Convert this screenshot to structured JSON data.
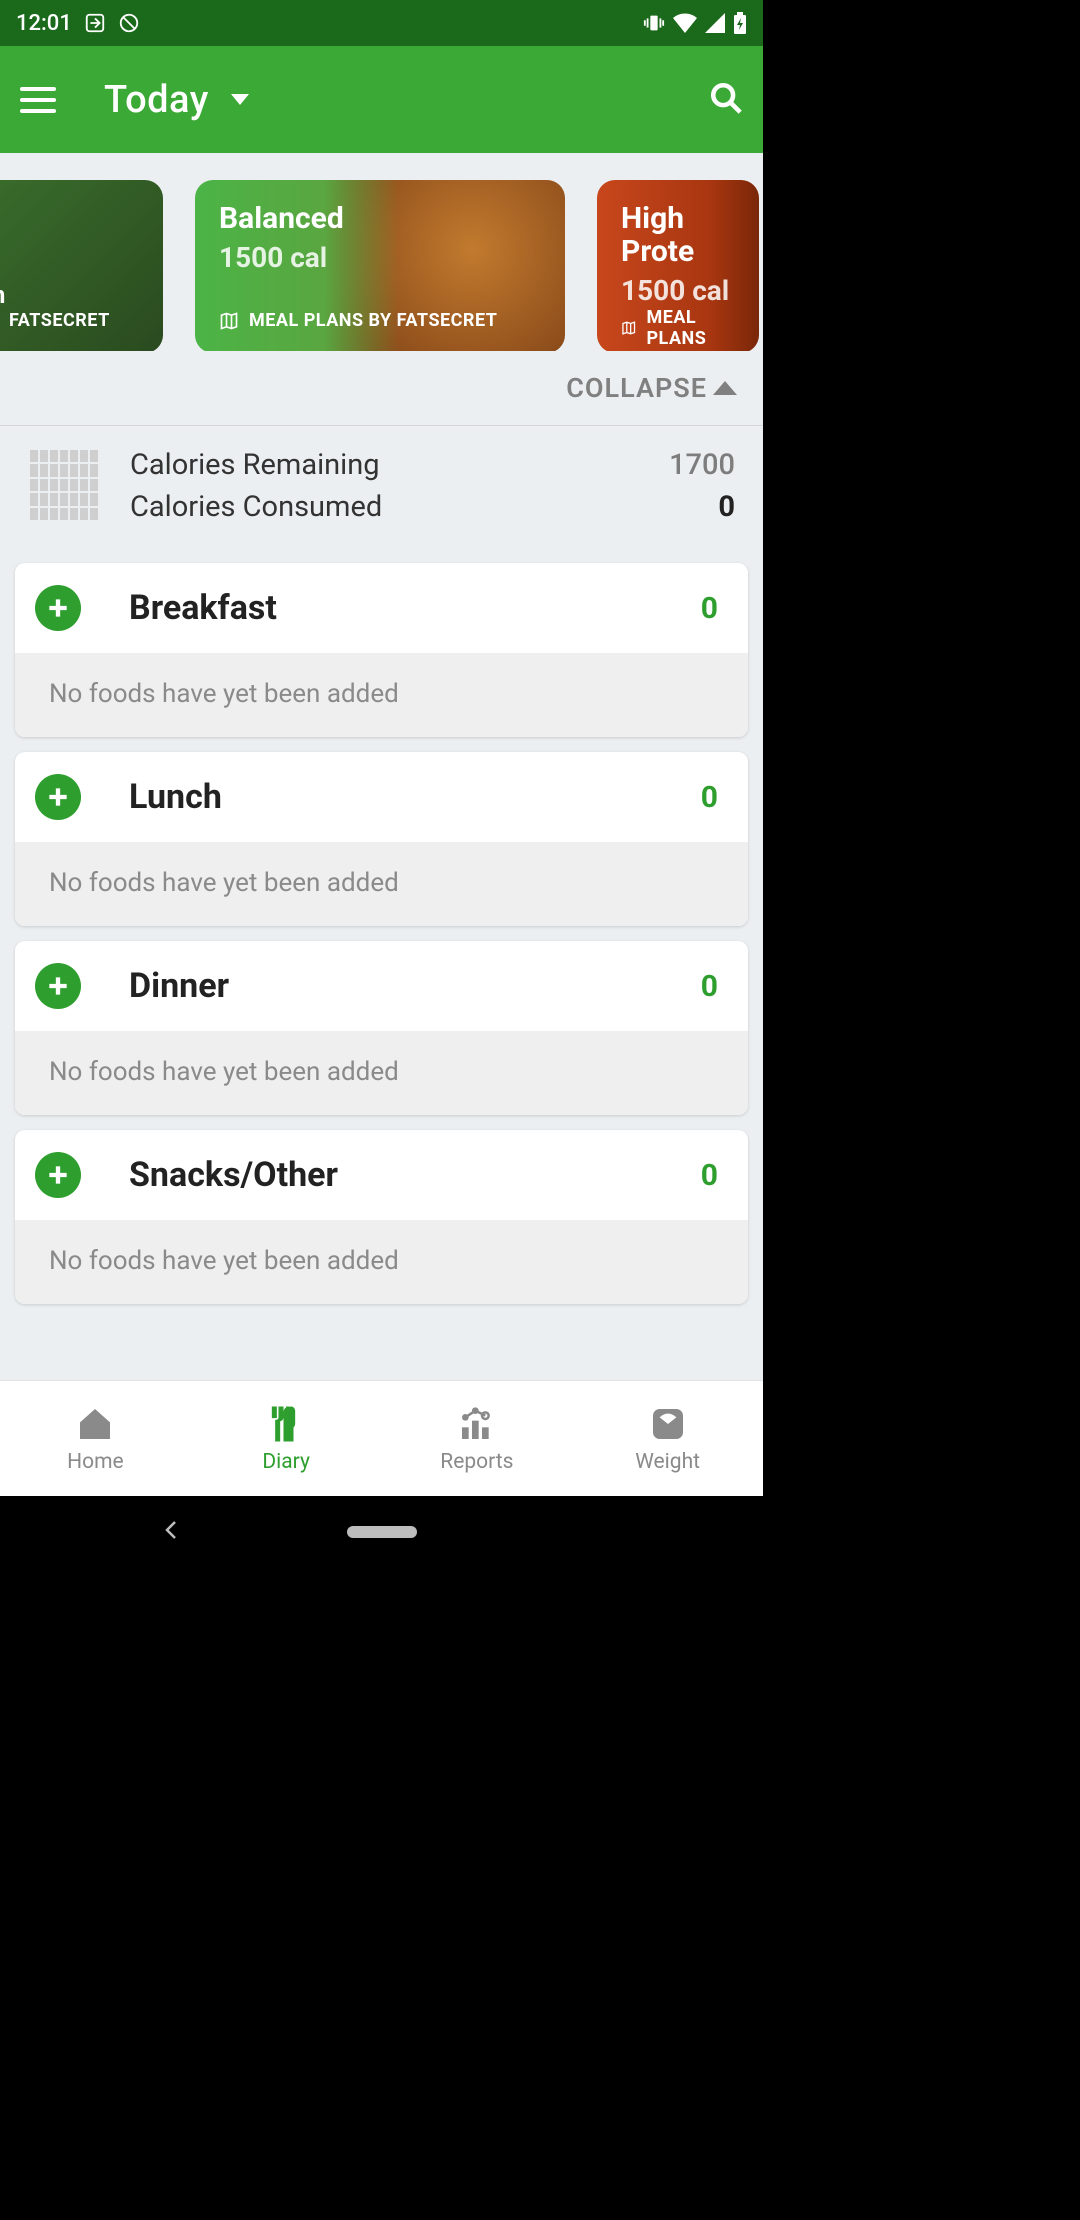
{
  "status": {
    "time": "12:01"
  },
  "header": {
    "title": "Today"
  },
  "carousel": [
    {
      "title": "an",
      "subtitle": "",
      "footer": "FATSECRET"
    },
    {
      "title": "Balanced",
      "subtitle": "1500 cal",
      "footer": "MEAL PLANS BY FATSECRET"
    },
    {
      "title": "High Prote",
      "subtitle": "1500 cal",
      "footer": "MEAL PLANS"
    }
  ],
  "collapse_label": "COLLAPSE",
  "summary": {
    "remaining_label": "Calories Remaining",
    "remaining_value": "1700",
    "consumed_label": "Calories Consumed",
    "consumed_value": "0"
  },
  "meals": [
    {
      "name": "Breakfast",
      "value": "0",
      "empty": "No foods have yet been added"
    },
    {
      "name": "Lunch",
      "value": "0",
      "empty": "No foods have yet been added"
    },
    {
      "name": "Dinner",
      "value": "0",
      "empty": "No foods have yet been added"
    },
    {
      "name": "Snacks/Other",
      "value": "0",
      "empty": "No foods have yet been added"
    }
  ],
  "nav": {
    "home": "Home",
    "diary": "Diary",
    "reports": "Reports",
    "weight": "Weight"
  }
}
